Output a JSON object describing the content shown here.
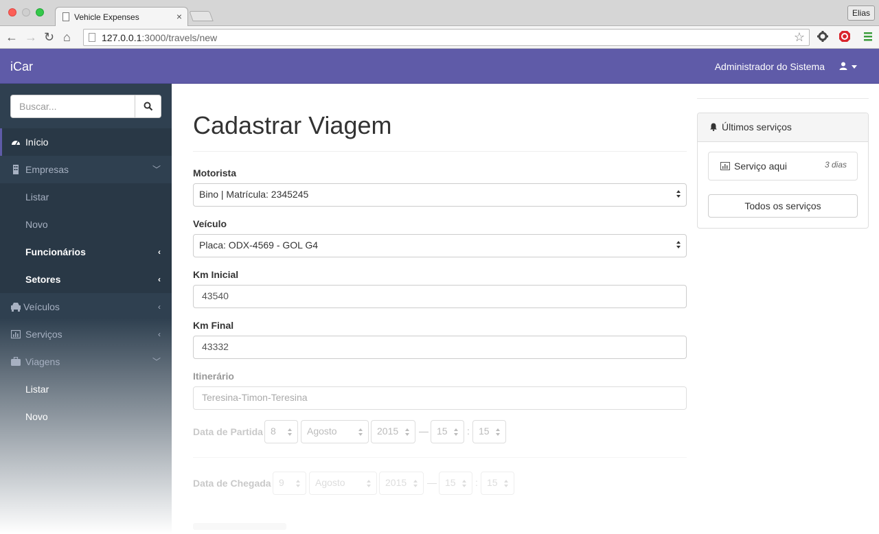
{
  "browser": {
    "tab_title": "Vehicle Expenses",
    "tab_close": "×",
    "profile_name": "Elias",
    "url_host": "127.0.0.1",
    "url_path": ":3000/travels/new"
  },
  "navbar": {
    "brand": "iCar",
    "user_name": "Administrador do Sistema"
  },
  "sidebar": {
    "search_placeholder": "Buscar...",
    "items": [
      {
        "label": "Início",
        "icon": "dashboard-icon"
      },
      {
        "label": "Empresas",
        "icon": "building-icon"
      },
      {
        "label": "Listar"
      },
      {
        "label": "Novo"
      },
      {
        "label": "Funcionários"
      },
      {
        "label": "Setores"
      },
      {
        "label": "Veículos",
        "icon": "car-icon"
      },
      {
        "label": "Serviços",
        "icon": "bar-chart-icon"
      },
      {
        "label": "Viagens",
        "icon": "suitcase-icon"
      },
      {
        "label": "Listar"
      },
      {
        "label": "Novo"
      }
    ]
  },
  "form": {
    "title": "Cadastrar Viagem",
    "motorista_label": "Motorista",
    "motorista_value": "Bino | Matrícula: 2345245",
    "veiculo_label": "Veículo",
    "veiculo_value": "Placa: ODX-4569 - GOL G4",
    "km_inicial_label": "Km Inicial",
    "km_inicial_value": "43540",
    "km_final_label": "Km Final",
    "km_final_value": "43332",
    "itinerario_label": "Itinerário",
    "itinerario_value": "Teresina-Timon-Teresina",
    "partida": {
      "label": "Data de Partida",
      "day": "8",
      "month": "Agosto",
      "year": "2015",
      "hour": "15",
      "minute": "15"
    },
    "chegada": {
      "label": "Data de Chegada",
      "day": "9",
      "month": "Agosto",
      "year": "2015",
      "hour": "15",
      "minute": "15"
    },
    "dash": "—",
    "colon": ":"
  },
  "services_panel": {
    "title": "Últimos serviços",
    "item_label": "Serviço aqui",
    "item_time": "3 dias",
    "all_button": "Todos os serviços"
  },
  "colors": {
    "navbar": "#5f5ba8",
    "sidebar": "#2f4050"
  }
}
